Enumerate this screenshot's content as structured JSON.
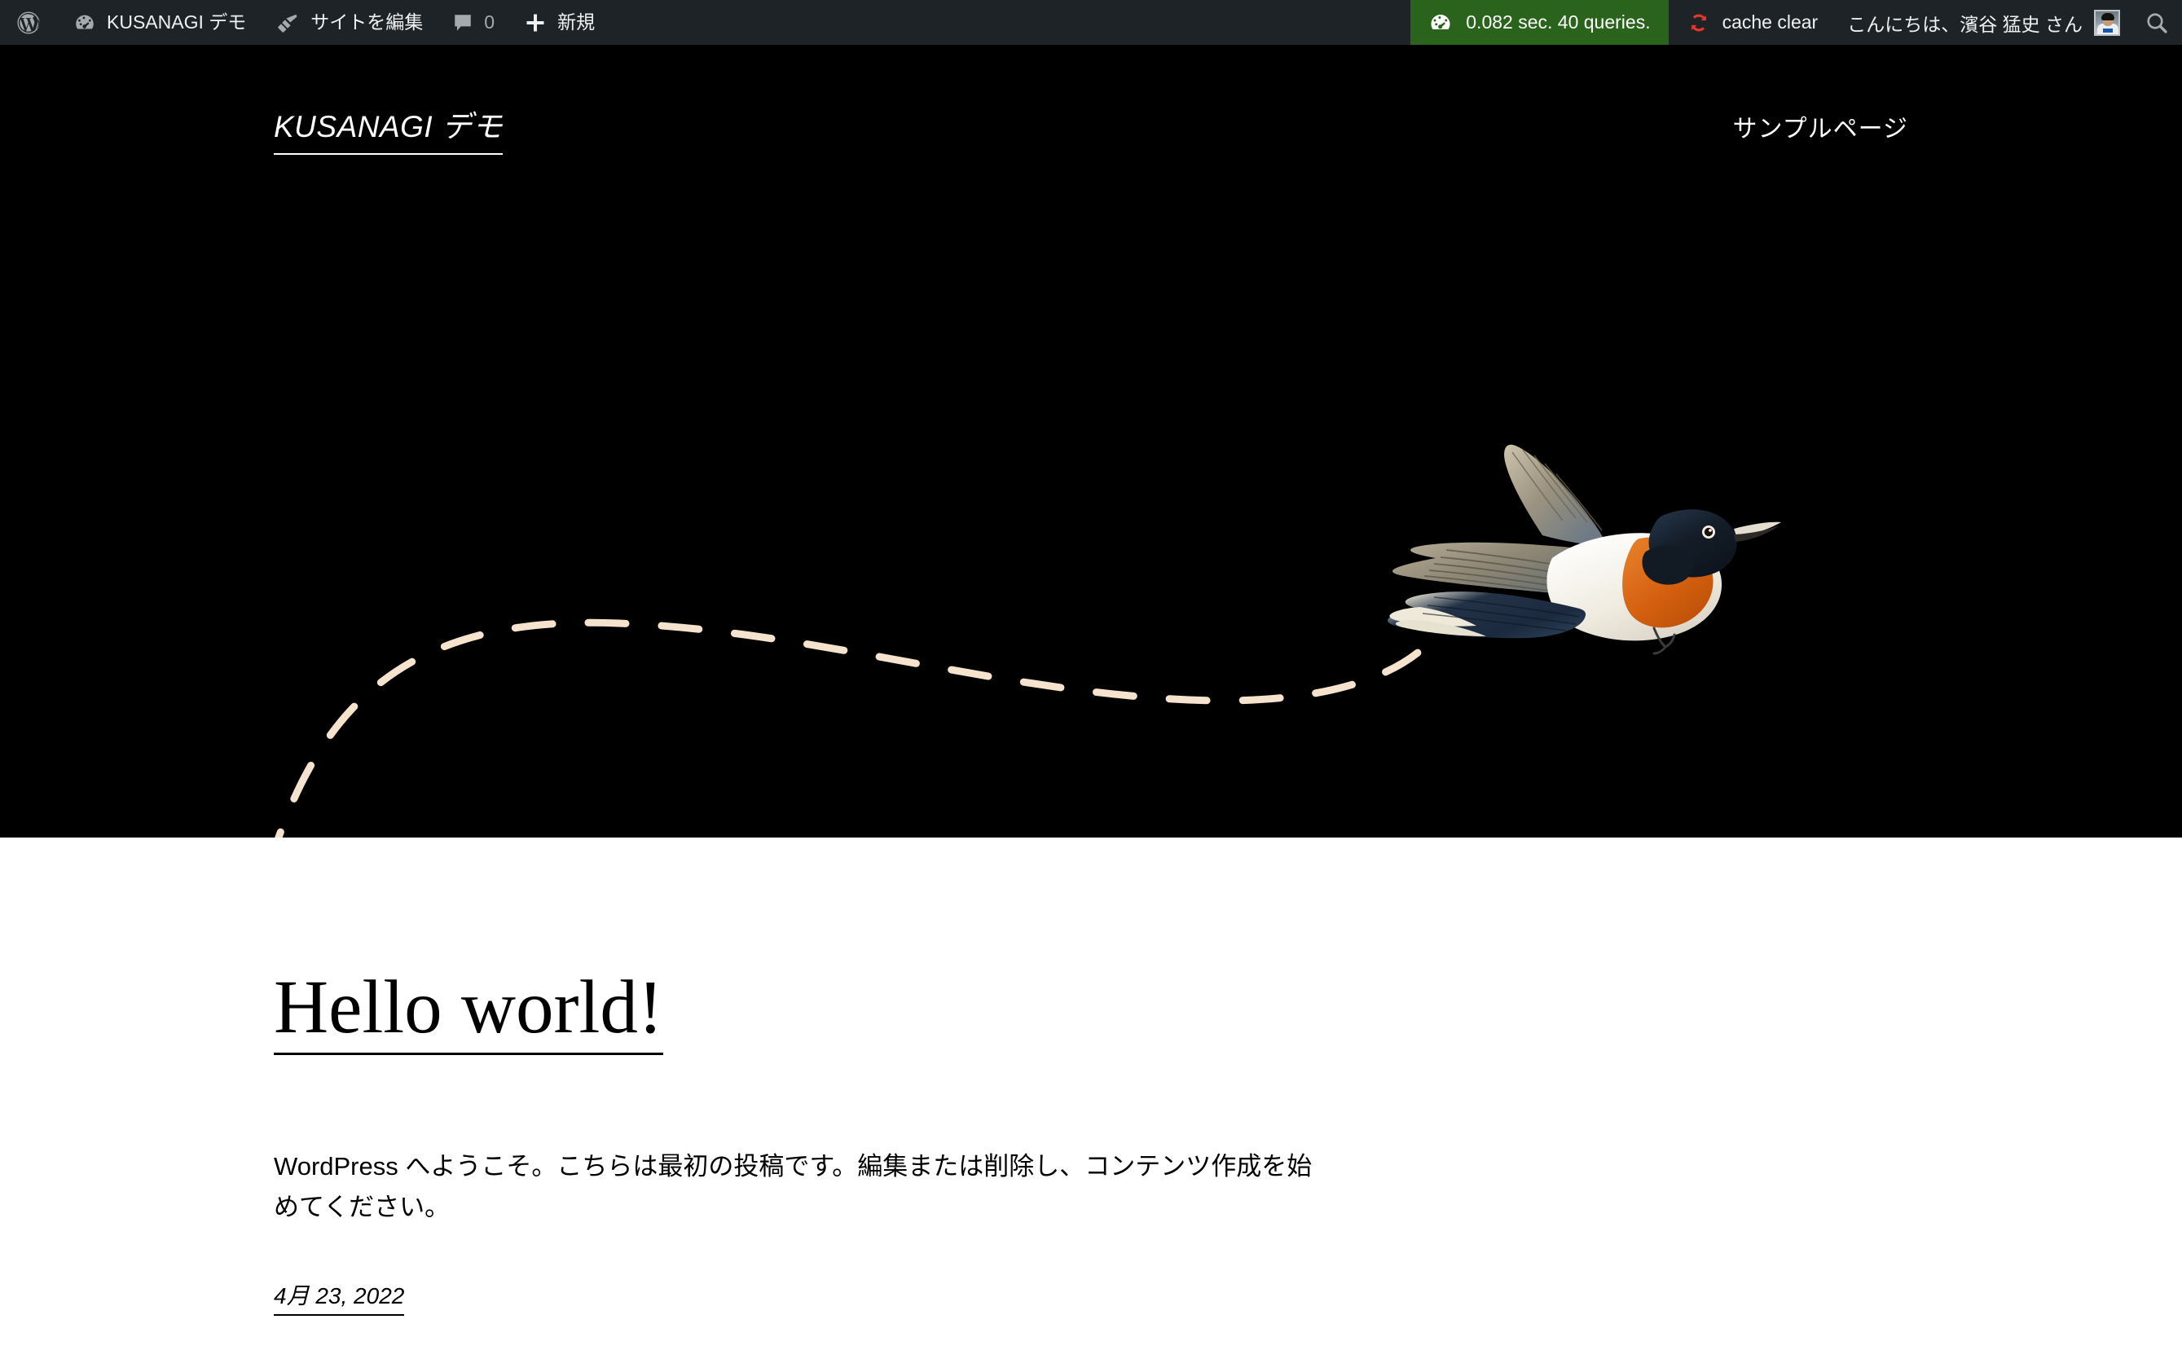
{
  "admin_bar": {
    "wp_logo_label": "",
    "items": [
      {
        "id": "wp-logo",
        "icon": "wordpress-logo-icon",
        "label": ""
      },
      {
        "id": "site-name",
        "icon": "dashboard-icon",
        "label": "KUSANAGI デモ"
      },
      {
        "id": "edit-site",
        "icon": "paintbrush-icon",
        "label": "サイトを編集"
      },
      {
        "id": "comments",
        "icon": "comment-bubble-icon",
        "label": "0"
      },
      {
        "id": "new-content",
        "icon": "plus-icon",
        "label": "新規"
      }
    ],
    "site_name": "KUSANAGI デモ",
    "edit_site": "サイトを編集",
    "comment_count": "0",
    "new_content": "新規",
    "perf_badge": {
      "text": "0.082 sec. 40 queries.",
      "seconds": "0.082",
      "queries": "40",
      "bg_color": "#2a631b",
      "icon": "speedometer-icon"
    },
    "cache_clear": {
      "label": "cache clear",
      "icon": "refresh-icon",
      "icon_color": "#e0392b"
    },
    "howdy": "こんにちは、濱谷 猛史 さん",
    "avatar_alt": "濱谷 猛史",
    "search_icon": "search-icon",
    "bg_color": "#1d2327",
    "text_color": "#f0f0f1",
    "muted_color": "#a7aaad"
  },
  "hero": {
    "site_title": "KUSANAGI デモ",
    "nav": [
      {
        "label": "サンプルページ"
      }
    ],
    "bg_color": "#000000",
    "illustration": {
      "name": "flying-bird-with-dashed-trail",
      "trail_color": "#f6e3cd",
      "bird_colors": {
        "head": "#1b2a3c",
        "breast": "#d9651a",
        "belly": "#f0ece0",
        "wing": "#8c8270",
        "tail": "#1f3146"
      }
    }
  },
  "post": {
    "title": "Hello world!",
    "excerpt": "WordPress へようこそ。こちらは最初の投稿です。編集または削除し、コンテンツ作成を始めてください。",
    "date": "4月 23, 2022"
  }
}
